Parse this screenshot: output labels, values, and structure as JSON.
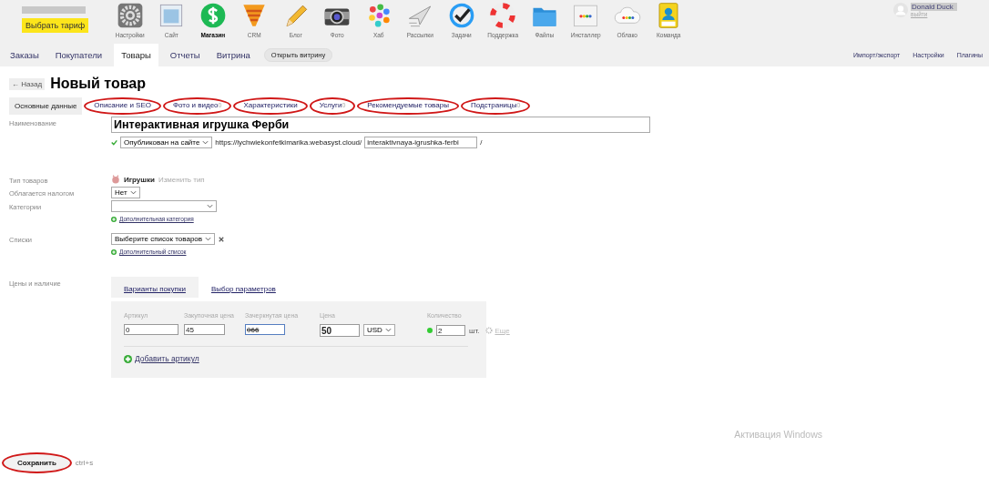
{
  "account": {
    "plan_button": "Выбрать тариф"
  },
  "apps": [
    {
      "label": "Настройки",
      "selected": false
    },
    {
      "label": "Сайт",
      "selected": false
    },
    {
      "label": "Магазин",
      "selected": true
    },
    {
      "label": "CRM",
      "selected": false
    },
    {
      "label": "Блог",
      "selected": false
    },
    {
      "label": "Фото",
      "selected": false
    },
    {
      "label": "Хаб",
      "selected": false
    },
    {
      "label": "Рассылки",
      "selected": false
    },
    {
      "label": "Задачи",
      "selected": false
    },
    {
      "label": "Поддержка",
      "selected": false
    },
    {
      "label": "Файлы",
      "selected": false
    },
    {
      "label": "Инсталлер",
      "selected": false
    },
    {
      "label": "Облако",
      "selected": false
    },
    {
      "label": "Команда",
      "selected": false
    }
  ],
  "user": {
    "name": "Donald Duck",
    "logout": "выйти"
  },
  "nav_tabs": [
    {
      "label": "Заказы",
      "selected": false
    },
    {
      "label": "Покупатели",
      "selected": false
    },
    {
      "label": "Товары",
      "selected": true
    },
    {
      "label": "Отчеты",
      "selected": false
    },
    {
      "label": "Витрина",
      "selected": false
    }
  ],
  "open_storefront_button": "Открыть витрину",
  "nav_right": [
    "Импорт/экспорт",
    "Настройки",
    "Плагины"
  ],
  "page": {
    "back_button": "← Назад",
    "title": "Новый товар"
  },
  "section_tabs": [
    {
      "label": "Основные данные",
      "selected": true,
      "circled": false
    },
    {
      "label": "Описание и SEO",
      "selected": false,
      "circled": true
    },
    {
      "label": "Фото и видео",
      "count": "0",
      "selected": false,
      "circled": true
    },
    {
      "label": "Характеристики",
      "selected": false,
      "circled": true
    },
    {
      "label": "Услуги",
      "count": "0",
      "selected": false,
      "circled": true
    },
    {
      "label": "Рекомендуемые товары",
      "selected": false,
      "circled": true
    },
    {
      "label": "Подстраницы",
      "count": "0",
      "selected": false,
      "circled": true
    }
  ],
  "form": {
    "name_label": "Наименование",
    "name_value": "Интерактивная игрушка Ферби",
    "status_select": "Опубликован на сайте",
    "url_prefix": "https://lychwiekonfetkimarika.webasyst.cloud/",
    "url_slug": "interaktivnaya-igrushka-ferbi",
    "url_suffix": "/",
    "type_label": "Тип товаров",
    "type_value": "Игрушки",
    "type_change": "Изменить тип",
    "tax_label": "Облагается налогом",
    "tax_value": "Нет",
    "categories_label": "Категории",
    "add_category": "Дополнительная категория",
    "lists_label": "Списки",
    "lists_value": "Выберите список товаров",
    "add_list": "Дополнительный список",
    "prices_label": "Цены и наличие"
  },
  "sku_tabs": [
    {
      "label": "Варианты покупки",
      "selected": true
    },
    {
      "label": "Выбор параметров",
      "selected": false
    }
  ],
  "sku_columns": [
    "Артикул",
    "Закупочная цена",
    "Зачеркнутая цена",
    "Цена",
    "Количество"
  ],
  "sku_row": {
    "sku": "0",
    "purchase_price": "45",
    "compare_price": "066",
    "price": "50",
    "currency": "USD",
    "in_stock": true,
    "quantity": "2",
    "unit": "шт.",
    "more": "Еще"
  },
  "add_sku": "Добавить артикул",
  "save_button": "Сохранить",
  "save_hint": "ctrl+s",
  "os_notice": "Активация Windows"
}
